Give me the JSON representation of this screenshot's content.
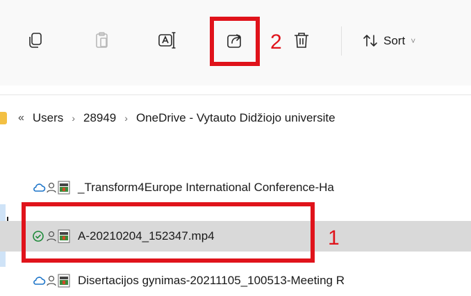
{
  "toolbar": {
    "sort_label": "Sort",
    "sort_chevron": "˅",
    "icons": [
      "copy-icon",
      "paste-icon",
      "rename-icon",
      "share-icon",
      "delete-icon",
      "sort-icon"
    ]
  },
  "annotations": {
    "step_share": "2",
    "step_file": "1",
    "highlight_color": "#e0131b"
  },
  "breadcrumb": {
    "overflow": "«",
    "separator": "›",
    "items": [
      "Users",
      "28949",
      "OneDrive - Vytauto Didžiojo universite"
    ]
  },
  "files": [
    {
      "name": "_Transform4Europe International Conference-Ha",
      "status": "cloud",
      "selected": false
    },
    {
      "name": "A-20210204_152347.mp4",
      "status": "available",
      "selected": true
    },
    {
      "name": "Disertacijos gynimas-20211105_100513-Meeting R",
      "status": "cloud",
      "selected": false
    }
  ]
}
